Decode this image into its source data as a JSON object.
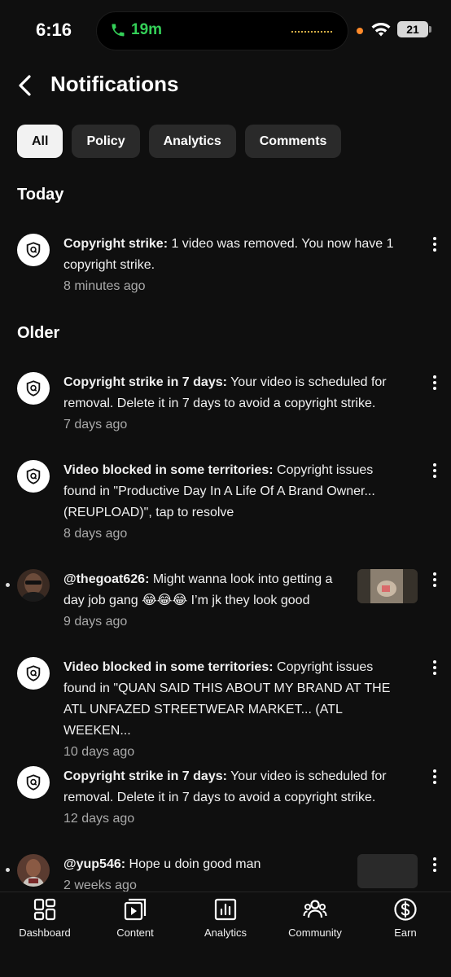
{
  "status_bar": {
    "time": "6:16",
    "call_duration": "19m",
    "battery": "21"
  },
  "header": {
    "title": "Notifications"
  },
  "filters": [
    {
      "label": "All",
      "active": true
    },
    {
      "label": "Policy",
      "active": false
    },
    {
      "label": "Analytics",
      "active": false
    },
    {
      "label": "Comments",
      "active": false
    }
  ],
  "sections": {
    "today": "Today",
    "older": "Older"
  },
  "notifications": [
    {
      "type": "policy",
      "bold": "Copyright strike:",
      "text": " 1 video was removed. You now have 1 copyright strike.",
      "time": "8 minutes ago"
    },
    {
      "type": "policy",
      "bold": "Copyright strike in 7 days:",
      "text": " Your video is scheduled for removal. Delete it in 7 days to avoid a copyright strike.",
      "time": "7 days ago"
    },
    {
      "type": "policy",
      "bold": "Video blocked in some territories:",
      "text": " Copyright issues found in \"Productive Day In A Life Of A Brand Owner... (REUPLOAD)\", tap to resolve",
      "time": "8 days ago"
    },
    {
      "type": "comment",
      "bold": "@thegoat626:",
      "text": " Might wanna look into getting a day job gang 😂😂😂 I’m jk they look good",
      "time": "9 days ago"
    },
    {
      "type": "policy",
      "bold": "Video blocked in some territories:",
      "text": " Copyright issues found in \"QUAN SAID THIS ABOUT MY BRAND AT THE ATL UNFAZED STREETWEAR MARKET... (ATL WEEKEN...",
      "time": "10 days ago"
    },
    {
      "type": "policy",
      "bold": "Copyright strike in 7 days:",
      "text": " Your video is scheduled for removal. Delete it in 7 days to avoid a copyright strike.",
      "time": "12 days ago"
    },
    {
      "type": "comment",
      "bold": "@yup546:",
      "text": " Hope u doin good man",
      "time": "2 weeks ago"
    }
  ],
  "bottom_nav": [
    {
      "label": "Dashboard",
      "icon": "dashboard-icon"
    },
    {
      "label": "Content",
      "icon": "content-icon"
    },
    {
      "label": "Analytics",
      "icon": "analytics-icon"
    },
    {
      "label": "Community",
      "icon": "community-icon"
    },
    {
      "label": "Earn",
      "icon": "earn-icon"
    }
  ],
  "colors": {
    "background": "#0f0f0f",
    "chip": "#2a2a2a",
    "chip_active": "#f2f2f2",
    "call_green": "#34d058",
    "muted_text": "#aaaaaa"
  }
}
